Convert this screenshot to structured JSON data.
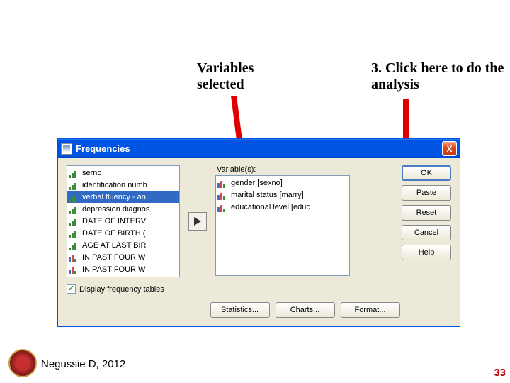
{
  "annotations": {
    "label1": "Variables selected",
    "label2": "3. Click here to do the analysis"
  },
  "dialog": {
    "title": "Frequencies",
    "close": "X",
    "leftList": [
      {
        "icon": "scale",
        "label": "serno"
      },
      {
        "icon": "scale",
        "label": "identification numb"
      },
      {
        "icon": "scale",
        "label": "verbal fluency - an",
        "sel": true
      },
      {
        "icon": "scale",
        "label": "depression diagnos"
      },
      {
        "icon": "scale",
        "label": "DATE OF INTERV"
      },
      {
        "icon": "scale",
        "label": "DATE OF BIRTH ("
      },
      {
        "icon": "scale",
        "label": "AGE AT LAST BIR"
      },
      {
        "icon": "nom",
        "label": "IN PAST FOUR W"
      },
      {
        "icon": "nom",
        "label": "IN PAST FOUR W"
      }
    ],
    "rightLabel": "Variable(s):",
    "rightList": [
      {
        "icon": "nom",
        "label": "gender [sexno]"
      },
      {
        "icon": "nom",
        "label": "marital status [marry]"
      },
      {
        "icon": "nom",
        "label": "educational level [educ"
      }
    ],
    "buttons": {
      "ok": "OK",
      "paste": "Paste",
      "reset": "Reset",
      "cancel": "Cancel",
      "help": "Help"
    },
    "checkbox": "Display frequency tables",
    "bottom": {
      "stats": "Statistics...",
      "charts": "Charts...",
      "format": "Format..."
    }
  },
  "footer": {
    "author": "Negussie D, 2012",
    "page": "33"
  }
}
